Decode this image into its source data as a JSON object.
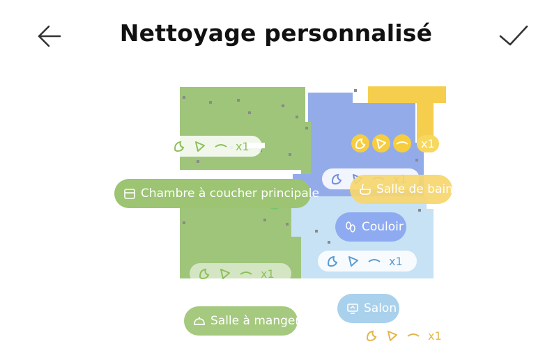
{
  "header": {
    "title": "Nettoyage personnalisé",
    "back_icon": "arrow-left-icon",
    "confirm_icon": "checkmark-icon"
  },
  "colors": {
    "green": "#9cc472",
    "yellow": "#f6cd3e",
    "blue": "#8eaaf0",
    "light_blue": "#a9d1ec"
  },
  "rooms": {
    "master_bedroom": {
      "label": "Chambre à coucher principale",
      "icon": "bed-icon",
      "count": "x1"
    },
    "bathroom": {
      "label": "Salle de bain",
      "icon": "bathtub-icon",
      "count": "x1"
    },
    "corridor": {
      "label": "Couloir",
      "icon": "footprints-icon",
      "count": "x1"
    },
    "dining_room": {
      "label": "Salle à manger",
      "icon": "cloche-icon",
      "count": "x1"
    },
    "living_room": {
      "label": "Salon",
      "icon": "tv-icon",
      "count": "x1"
    }
  }
}
